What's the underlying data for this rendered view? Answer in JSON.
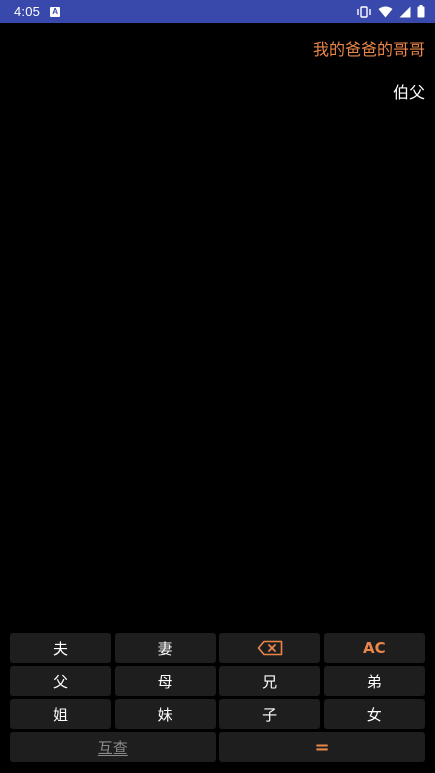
{
  "status_bar": {
    "time": "4:05",
    "app_icon_letter": "A"
  },
  "display": {
    "expression": "我的爸爸的哥哥",
    "result": "伯父"
  },
  "keypad": {
    "rows": [
      [
        "夫",
        "妻",
        "",
        "AC"
      ],
      [
        "父",
        "母",
        "兄",
        "弟"
      ],
      [
        "姐",
        "妹",
        "子",
        "女"
      ]
    ],
    "query_label": "互查",
    "equals_label": "="
  },
  "colors": {
    "status_bar": "#3949ab",
    "accent": "#e9864a",
    "key_bg": "#1e1e1e",
    "background": "#000000"
  }
}
